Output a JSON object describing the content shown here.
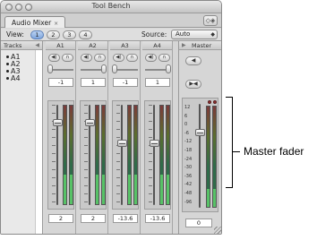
{
  "window": {
    "title": "Tool Bench"
  },
  "tab": {
    "label": "Audio Mixer"
  },
  "viewbar": {
    "view_label": "View:",
    "view_buttons": [
      "1",
      "2",
      "3",
      "4"
    ],
    "active_view": "1",
    "source_label": "Source:",
    "source_value": "Auto"
  },
  "tracks_panel": {
    "header": "Tracks",
    "items": [
      "A1",
      "A2",
      "A3",
      "A4"
    ]
  },
  "strips": [
    {
      "name": "A1",
      "pan_value": "-1",
      "level_value": "2",
      "fader_db": 2,
      "meter_level": 0.3
    },
    {
      "name": "A2",
      "pan_value": "1",
      "level_value": "2",
      "fader_db": 2,
      "meter_level": 0.3
    },
    {
      "name": "A3",
      "pan_value": "-1",
      "level_value": "-13.6",
      "fader_db": -13.6,
      "meter_level": 0.3
    },
    {
      "name": "A4",
      "pan_value": "1",
      "level_value": "-13.6",
      "fader_db": -13.6,
      "meter_level": 0.3
    }
  ],
  "master": {
    "header": "Master",
    "scale_labels": [
      "12",
      "6",
      "0",
      "-6",
      "-12",
      "-18",
      "-24",
      "-30",
      "-36",
      "-42",
      "-48",
      "-96"
    ],
    "value": "0",
    "meter_level": 0.18
  },
  "callout": {
    "text": "Master fader"
  },
  "icons": {
    "mute": "speaker-icon",
    "solo": "headphones-icon",
    "master_mute": "speaker-icon",
    "master_downmix": "downmix-icon"
  }
}
